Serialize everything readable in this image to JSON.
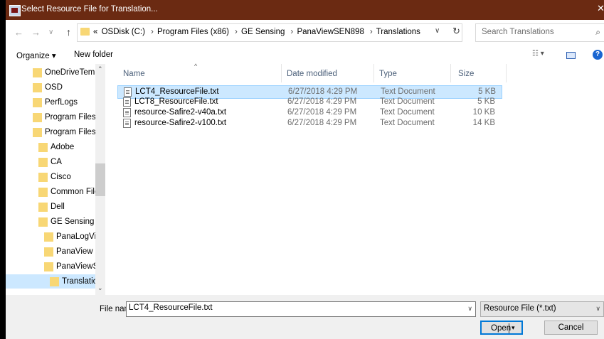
{
  "window": {
    "title": "Select Resource File for Translation...",
    "close_glyph": "✕"
  },
  "address": {
    "back_glyph": "←",
    "forward_glyph": "→",
    "recent_glyph": "∨",
    "up_glyph": "↑",
    "crumbs": [
      "«",
      "OSDisk (C:)",
      "Program Files (x86)",
      "GE Sensing",
      "PanaViewSEN898",
      "Translations"
    ],
    "separator": "›",
    "dropdown_glyph": "∨",
    "refresh_glyph": "↻",
    "search_placeholder": "Search Translations",
    "search_glyph": "⌕"
  },
  "toolbar": {
    "organize_label": "Organize ▾",
    "new_folder_label": "New folder",
    "view_glyph": "☷ ▾",
    "help_glyph": "?"
  },
  "nav": {
    "scroll_up": "⌃",
    "scroll_down": "⌄",
    "items": [
      {
        "label": "OneDriveTemp",
        "indent": 0
      },
      {
        "label": "OSD",
        "indent": 0
      },
      {
        "label": "PerfLogs",
        "indent": 0
      },
      {
        "label": "Program Files",
        "indent": 0
      },
      {
        "label": "Program Files (",
        "indent": 0
      },
      {
        "label": "Adobe",
        "indent": 1
      },
      {
        "label": "CA",
        "indent": 1
      },
      {
        "label": "Cisco",
        "indent": 1
      },
      {
        "label": "Common File",
        "indent": 1
      },
      {
        "label": "Dell",
        "indent": 1
      },
      {
        "label": "GE Sensing",
        "indent": 1
      },
      {
        "label": "PanaLogVie",
        "indent": 2
      },
      {
        "label": "PanaView",
        "indent": 2
      },
      {
        "label": "PanaViewSE",
        "indent": 2
      },
      {
        "label": "Translatior",
        "indent": 3,
        "selected": true
      }
    ]
  },
  "files": {
    "columns": {
      "name": "Name",
      "date": "Date modified",
      "type": "Type",
      "size": "Size"
    },
    "sort_glyph": "^",
    "rows": [
      {
        "name": "LCT4_ResourceFile.txt",
        "date": "6/27/2018 4:29 PM",
        "type": "Text Document",
        "size": "5 KB",
        "selected": true
      },
      {
        "name": "LCT8_ResourceFile.txt",
        "date": "6/27/2018 4:29 PM",
        "type": "Text Document",
        "size": "5 KB"
      },
      {
        "name": "resource-Safire2-v40a.txt",
        "date": "6/27/2018 4:29 PM",
        "type": "Text Document",
        "size": "10 KB"
      },
      {
        "name": "resource-Safire2-v100.txt",
        "date": "6/27/2018 4:29 PM",
        "type": "Text Document",
        "size": "14 KB"
      }
    ]
  },
  "footer": {
    "file_name_label": "File name:",
    "file_name_value": "LCT4_ResourceFile.txt",
    "file_name_dropdown": "∨",
    "filter_value": "Resource File (*.txt)",
    "filter_dropdown": "∨",
    "open_label": "Open",
    "open_arrow": "▾",
    "cancel_label": "Cancel"
  },
  "colors": {
    "titlebar": "#6b2a12",
    "selection": "#cce8ff",
    "folder": "#f8d775",
    "accent": "#0078d7"
  }
}
